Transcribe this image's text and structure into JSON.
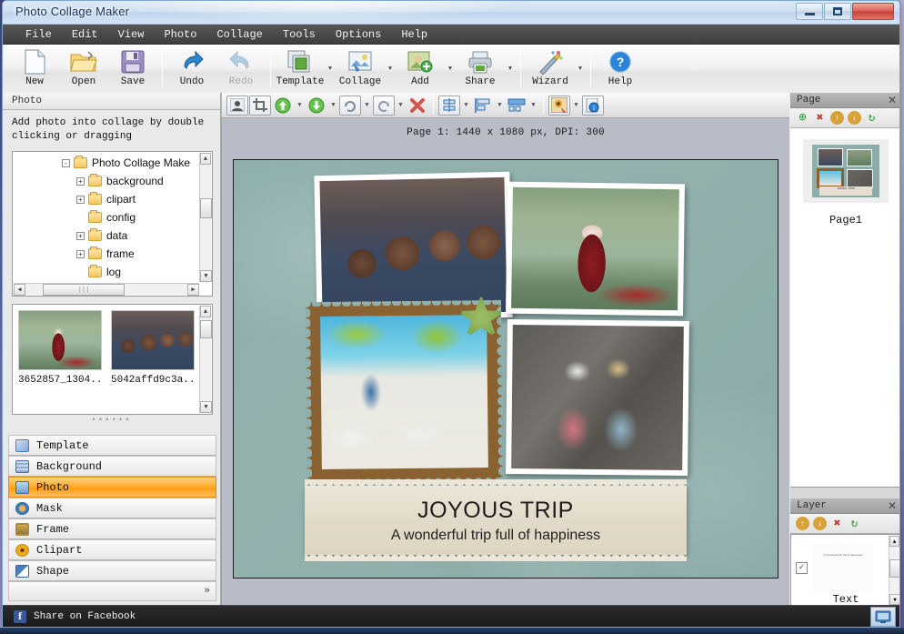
{
  "window": {
    "title": "Photo Collage Maker",
    "minimize_label": "Minimize",
    "maximize_label": "Maximize",
    "close_label": "X"
  },
  "menu": {
    "items": [
      "File",
      "Edit",
      "View",
      "Photo",
      "Collage",
      "Tools",
      "Options",
      "Help"
    ]
  },
  "toolbar": {
    "buttons": [
      {
        "label": "New",
        "icon": "new-document-icon"
      },
      {
        "label": "Open",
        "icon": "open-folder-icon"
      },
      {
        "label": "Save",
        "icon": "floppy-disk-icon"
      },
      {
        "label": "Undo",
        "icon": "undo-arrow-icon"
      },
      {
        "label": "Redo",
        "icon": "redo-arrow-icon"
      },
      {
        "label": "Template",
        "icon": "template-icon"
      },
      {
        "label": "Collage",
        "icon": "collage-icon"
      },
      {
        "label": "Add",
        "icon": "add-photo-icon"
      },
      {
        "label": "Share",
        "icon": "printer-share-icon"
      },
      {
        "label": "Wizard",
        "icon": "magic-wand-icon"
      },
      {
        "label": "Help",
        "icon": "help-question-icon"
      }
    ]
  },
  "sub_toolbar": {
    "buttons": [
      {
        "name": "portrait-icon"
      },
      {
        "name": "crop-icon"
      },
      {
        "name": "move-up-icon"
      },
      {
        "name": "move-down-icon"
      },
      {
        "name": "rotate-right-icon"
      },
      {
        "name": "rotate-left-icon"
      },
      {
        "name": "delete-icon"
      },
      {
        "name": "align-vertical-icon"
      },
      {
        "name": "align-left-icon"
      },
      {
        "name": "distribute-icon"
      },
      {
        "name": "effects-icon"
      },
      {
        "name": "info-icon"
      }
    ]
  },
  "canvas": {
    "page_info": "Page 1: 1440 x 1080 px, DPI: 300",
    "collage": {
      "ribbon_title": "JOYOUS TRIP",
      "ribbon_subtitle": "A wonderful trip full of happiness",
      "photos": [
        {
          "name": "party-friends-photo"
        },
        {
          "name": "garden-santa-photo"
        },
        {
          "name": "beach-stamp-photo"
        },
        {
          "name": "two-ladies-stairs-photo"
        }
      ],
      "clipart": [
        {
          "name": "starfish-clipart"
        }
      ]
    }
  },
  "left_panel": {
    "caption": "Photo",
    "hint": "Add photo into collage by double clicking or dragging",
    "tree": [
      {
        "label": "Photo Collage Make",
        "depth": 0,
        "expander": "-"
      },
      {
        "label": "background",
        "depth": 1,
        "expander": "+"
      },
      {
        "label": "clipart",
        "depth": 1,
        "expander": "+"
      },
      {
        "label": "config",
        "depth": 1,
        "expander": ""
      },
      {
        "label": "data",
        "depth": 1,
        "expander": "+"
      },
      {
        "label": "frame",
        "depth": 1,
        "expander": "+"
      },
      {
        "label": "log",
        "depth": 1,
        "expander": ""
      }
    ],
    "thumbnails": [
      {
        "caption": "3652857_1304...",
        "name": "thumbnail-santa-garden"
      },
      {
        "caption": "5042affd9c3a...",
        "name": "thumbnail-party-friends"
      }
    ],
    "categories": [
      {
        "label": "Template",
        "icon": "template-icon",
        "active": false,
        "color": "#5b8ec9"
      },
      {
        "label": "Background",
        "icon": "background-icon",
        "active": false,
        "color": "#6f8fb5"
      },
      {
        "label": "Photo",
        "icon": "photo-icon",
        "active": true,
        "color": "#4a90d9"
      },
      {
        "label": "Mask",
        "icon": "mask-icon",
        "active": false,
        "color": "#3b7fc4"
      },
      {
        "label": "Frame",
        "icon": "frame-icon",
        "active": false,
        "color": "#b08a3e"
      },
      {
        "label": "Clipart",
        "icon": "clipart-icon",
        "active": false,
        "color": "#f0a81e"
      },
      {
        "label": "Shape",
        "icon": "shape-icon",
        "active": false,
        "color": "#4a7fc0"
      }
    ],
    "more_label": "»"
  },
  "right_panel": {
    "page": {
      "caption": "Page",
      "close": "✕",
      "tools": [
        {
          "name": "add-page-icon",
          "glyph": "⊕",
          "color": "#2e9a3e"
        },
        {
          "name": "delete-page-icon",
          "glyph": "✖",
          "color": "#cc3b33"
        },
        {
          "name": "move-up-page-icon",
          "glyph": "↑",
          "color": "#d8a238"
        },
        {
          "name": "move-down-page-icon",
          "glyph": "↓",
          "color": "#d8a238"
        },
        {
          "name": "refresh-page-icon",
          "glyph": "↻",
          "color": "#2e9a3e"
        }
      ],
      "item_name": "Page1",
      "mini_caption": "JOYOUS TRIP"
    },
    "layer": {
      "caption": "Layer",
      "close": "✕",
      "tools": [
        {
          "name": "layer-up-icon",
          "glyph": "↑",
          "color": "#d8a238"
        },
        {
          "name": "layer-down-icon",
          "glyph": "↓",
          "color": "#d8a238"
        },
        {
          "name": "delete-layer-icon",
          "glyph": "✖",
          "color": "#cc3b33"
        },
        {
          "name": "refresh-layer-icon",
          "glyph": "↻",
          "color": "#2e9a3e"
        }
      ],
      "item_name": "Text",
      "item_checked": "✓",
      "item_preview_text": "A wonderful trip full of happiness"
    }
  },
  "status_bar": {
    "facebook_label": "Share on Facebook",
    "facebook_icon": "facebook-icon",
    "monitor_icon": "display-icon"
  },
  "colors": {
    "accent_orange": "#ffa726",
    "menu_dark": "#4a4a4a",
    "canvas_bg": "#b7bcc6",
    "collage_bg": "#8fb0ad",
    "stamp_brown": "#8a6231"
  }
}
